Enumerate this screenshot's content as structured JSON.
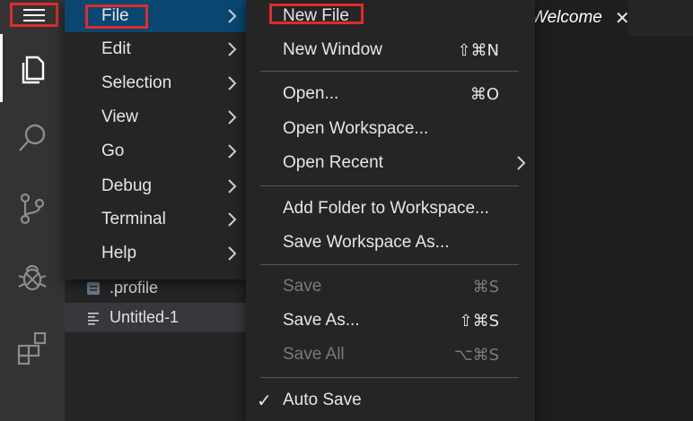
{
  "activity_bar": {
    "items": [
      {
        "name": "explorer-icon"
      },
      {
        "name": "search-icon"
      },
      {
        "name": "source-control-icon"
      },
      {
        "name": "debug-icon"
      },
      {
        "name": "extensions-icon"
      }
    ]
  },
  "sidebar": {
    "files": [
      ".profile",
      "Untitled-1"
    ]
  },
  "tab": {
    "label": "Welcome",
    "close": "✕"
  },
  "main_menu": {
    "items": [
      "File",
      "Edit",
      "Selection",
      "View",
      "Go",
      "Debug",
      "Terminal",
      "Help"
    ]
  },
  "file_menu": {
    "new_file": {
      "label": "New File",
      "shortcut": ""
    },
    "new_window": {
      "label": "New Window",
      "shortcut": "⇧⌘N"
    },
    "open": {
      "label": "Open...",
      "shortcut": "⌘O"
    },
    "open_workspace": {
      "label": "Open Workspace..."
    },
    "open_recent": {
      "label": "Open Recent"
    },
    "add_folder": {
      "label": "Add Folder to Workspace..."
    },
    "save_workspace_as": {
      "label": "Save Workspace As..."
    },
    "save": {
      "label": "Save",
      "shortcut": "⌘S"
    },
    "save_as": {
      "label": "Save As...",
      "shortcut": "⇧⌘S"
    },
    "save_all": {
      "label": "Save All",
      "shortcut": "⌥⌘S"
    },
    "auto_save": {
      "label": "Auto Save",
      "check": "✓"
    }
  },
  "colors": {
    "highlight": "#094771",
    "annotation": "#e02b2b"
  }
}
